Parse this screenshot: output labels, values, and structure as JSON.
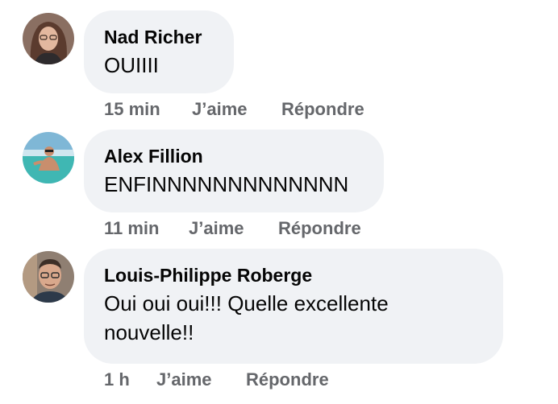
{
  "comments": [
    {
      "author": "Nad Richer",
      "text": "OUIIII",
      "time": "15 min",
      "like_label": "J’aime",
      "reply_label": "Répondre",
      "avatar_icon": "user-photo-nad-icon"
    },
    {
      "author": "Alex Fillion",
      "text": "ENFINNNNNNNNNNNNN",
      "time": "11 min",
      "like_label": "J’aime",
      "reply_label": "Répondre",
      "avatar_icon": "user-photo-alex-icon"
    },
    {
      "author": "Louis-Philippe Roberge",
      "text_line1": "Oui oui oui!!! Quelle excellente",
      "text_line2": "nouvelle!!",
      "time": "1 h",
      "like_label": "J’aime",
      "reply_label": "Répondre",
      "avatar_icon": "user-photo-louis-philippe-icon"
    }
  ],
  "colors": {
    "bubble": "#f0f2f5",
    "text": "#050505",
    "meta": "#65676b"
  }
}
